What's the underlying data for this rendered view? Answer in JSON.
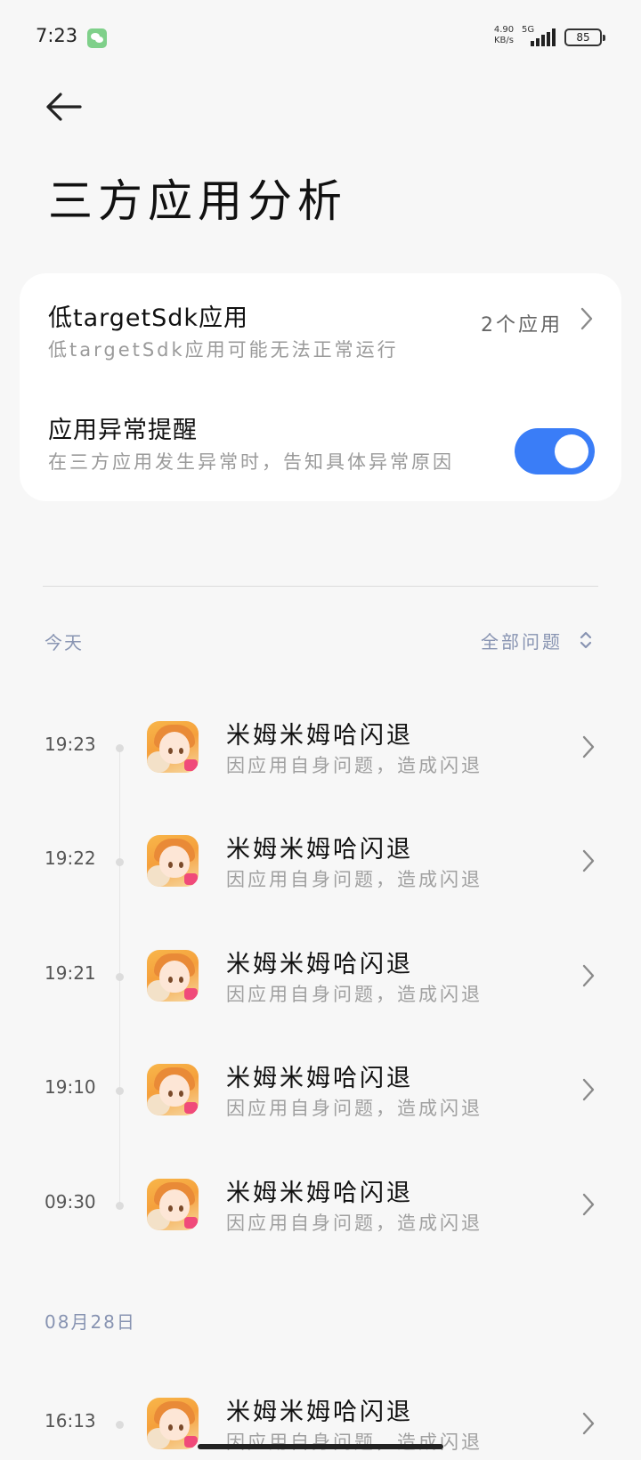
{
  "status_bar": {
    "time": "7:23",
    "net_speed_value": "4.90",
    "net_speed_unit": "KB/s",
    "net_type": "5G",
    "battery": "85",
    "icons": [
      "wechat-icon",
      "signal-icon",
      "battery-icon"
    ]
  },
  "header": {
    "back_icon": "arrow-left-icon",
    "title": "三方应用分析"
  },
  "settings": {
    "low_sdk": {
      "title": "低targetSdk应用",
      "subtitle": "低targetSdk应用可能无法正常运行",
      "value": "2个应用"
    },
    "crash_alert": {
      "title": "应用异常提醒",
      "subtitle": "在三方应用发生异常时，告知具体异常原因",
      "enabled": true
    },
    "accent_color": "#3a7df7"
  },
  "filter": {
    "label": "全部问题",
    "icon": "sort-updown-icon"
  },
  "sections": [
    {
      "date": "今天",
      "events": [
        {
          "time": "19:23",
          "app_icon": "app-icon-mimu",
          "title": "米姆米姆哈闪退",
          "subtitle": "因应用自身问题，造成闪退"
        },
        {
          "time": "19:22",
          "app_icon": "app-icon-mimu",
          "title": "米姆米姆哈闪退",
          "subtitle": "因应用自身问题，造成闪退"
        },
        {
          "time": "19:21",
          "app_icon": "app-icon-mimu",
          "title": "米姆米姆哈闪退",
          "subtitle": "因应用自身问题，造成闪退"
        },
        {
          "time": "19:10",
          "app_icon": "app-icon-mimu",
          "title": "米姆米姆哈闪退",
          "subtitle": "因应用自身问题，造成闪退"
        },
        {
          "time": "09:30",
          "app_icon": "app-icon-mimu",
          "title": "米姆米姆哈闪退",
          "subtitle": "因应用自身问题，造成闪退"
        }
      ]
    },
    {
      "date": "08月28日",
      "events": [
        {
          "time": "16:13",
          "app_icon": "app-icon-mimu",
          "title": "米姆米姆哈闪退",
          "subtitle": "因应用自身问题，造成闪退"
        }
      ]
    }
  ]
}
